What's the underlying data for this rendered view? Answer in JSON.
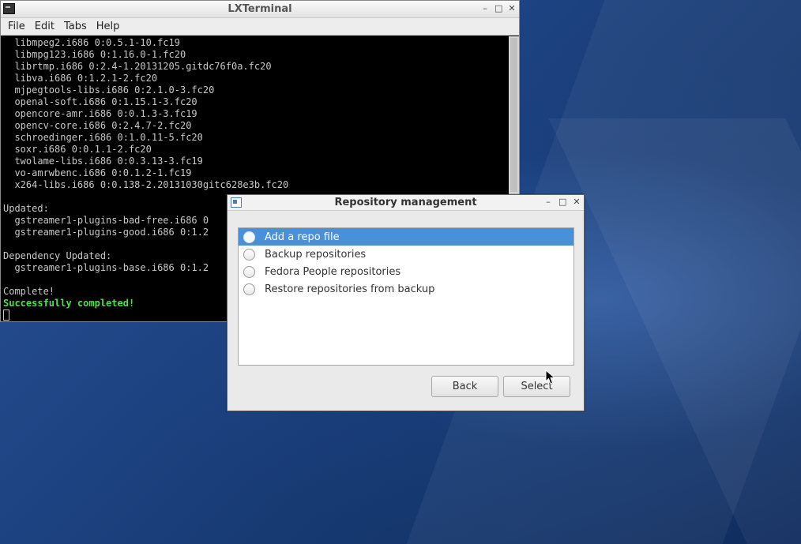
{
  "terminal": {
    "title": "LXTerminal",
    "menu": [
      "File",
      "Edit",
      "Tabs",
      "Help"
    ],
    "window_controls": [
      "–",
      "□",
      "✕"
    ],
    "lines": [
      "  libmpeg2.i686 0:0.5.1-10.fc19",
      "  libmpg123.i686 0:1.16.0-1.fc20",
      "  librtmp.i686 0:2.4-1.20131205.gitdc76f0a.fc20",
      "  libva.i686 0:1.2.1-2.fc20",
      "  mjpegtools-libs.i686 0:2.1.0-3.fc20",
      "  openal-soft.i686 0:1.15.1-3.fc20",
      "  opencore-amr.i686 0:0.1.3-3.fc19",
      "  opencv-core.i686 0:2.4.7-2.fc20",
      "  schroedinger.i686 0:1.0.11-5.fc20",
      "  soxr.i686 0:0.1.1-2.fc20",
      "  twolame-libs.i686 0:0.3.13-3.fc19",
      "  vo-amrwbenc.i686 0:0.1.2-1.fc19",
      "  x264-libs.i686 0:0.138-2.20131030gitc628e3b.fc20",
      "",
      "Updated:",
      "  gstreamer1-plugins-bad-free.i686 0",
      "  gstreamer1-plugins-good.i686 0:1.2",
      "",
      "Dependency Updated:",
      "  gstreamer1-plugins-base.i686 0:1.2",
      "",
      "Complete!"
    ],
    "success_line": "Successfully completed!"
  },
  "dialog": {
    "title": "Repository management",
    "window_controls": [
      "–",
      "□",
      "✕"
    ],
    "options": [
      {
        "label": "Add a repo file",
        "selected": true
      },
      {
        "label": "Backup repositories",
        "selected": false
      },
      {
        "label": "Fedora People repositories",
        "selected": false
      },
      {
        "label": "Restore repositories from backup",
        "selected": false
      }
    ],
    "back_label": "Back",
    "select_label": "Select"
  }
}
